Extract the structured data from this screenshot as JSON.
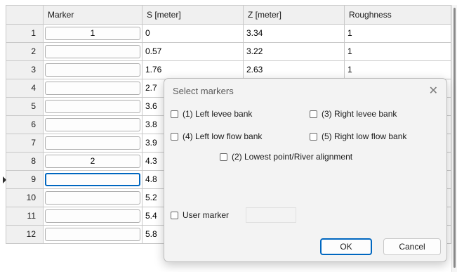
{
  "columns": [
    "Marker",
    "S [meter]",
    "Z [meter]",
    "Roughness"
  ],
  "rows": [
    {
      "num": "1",
      "marker": "1",
      "s": "0",
      "z": "3.34",
      "r": "1"
    },
    {
      "num": "2",
      "marker": "",
      "s": "0.57",
      "z": "3.22",
      "r": "1"
    },
    {
      "num": "3",
      "marker": "",
      "s": "1.76",
      "z": "2.63",
      "r": "1"
    },
    {
      "num": "4",
      "marker": "",
      "s": "2.7",
      "z": "",
      "r": ""
    },
    {
      "num": "5",
      "marker": "",
      "s": "3.6",
      "z": "",
      "r": ""
    },
    {
      "num": "6",
      "marker": "",
      "s": "3.8",
      "z": "",
      "r": ""
    },
    {
      "num": "7",
      "marker": "",
      "s": "3.9",
      "z": "",
      "r": ""
    },
    {
      "num": "8",
      "marker": "2",
      "s": "4.3",
      "z": "",
      "r": ""
    },
    {
      "num": "9",
      "marker": "",
      "s": "4.8",
      "z": "",
      "r": ""
    },
    {
      "num": "10",
      "marker": "",
      "s": "5.2",
      "z": "",
      "r": ""
    },
    {
      "num": "11",
      "marker": "",
      "s": "5.4",
      "z": "",
      "r": ""
    },
    {
      "num": "12",
      "marker": "",
      "s": "5.8",
      "z": "",
      "r": ""
    }
  ],
  "dialog": {
    "title": "Select markers",
    "close_glyph": "✕",
    "options": {
      "left_levee": "(1) Left levee bank",
      "right_levee": "(3) Right levee bank",
      "left_low": "(4) Left low flow bank",
      "right_low": "(5) Right low flow bank",
      "lowest": "(2) Lowest point/River alignment"
    },
    "user_marker_label": "User marker",
    "ok_label": "OK",
    "cancel_label": "Cancel"
  },
  "colors": {
    "accent": "#0067c0",
    "header_bg": "#f0f0f0",
    "dialog_bg": "#f3f3f3"
  }
}
